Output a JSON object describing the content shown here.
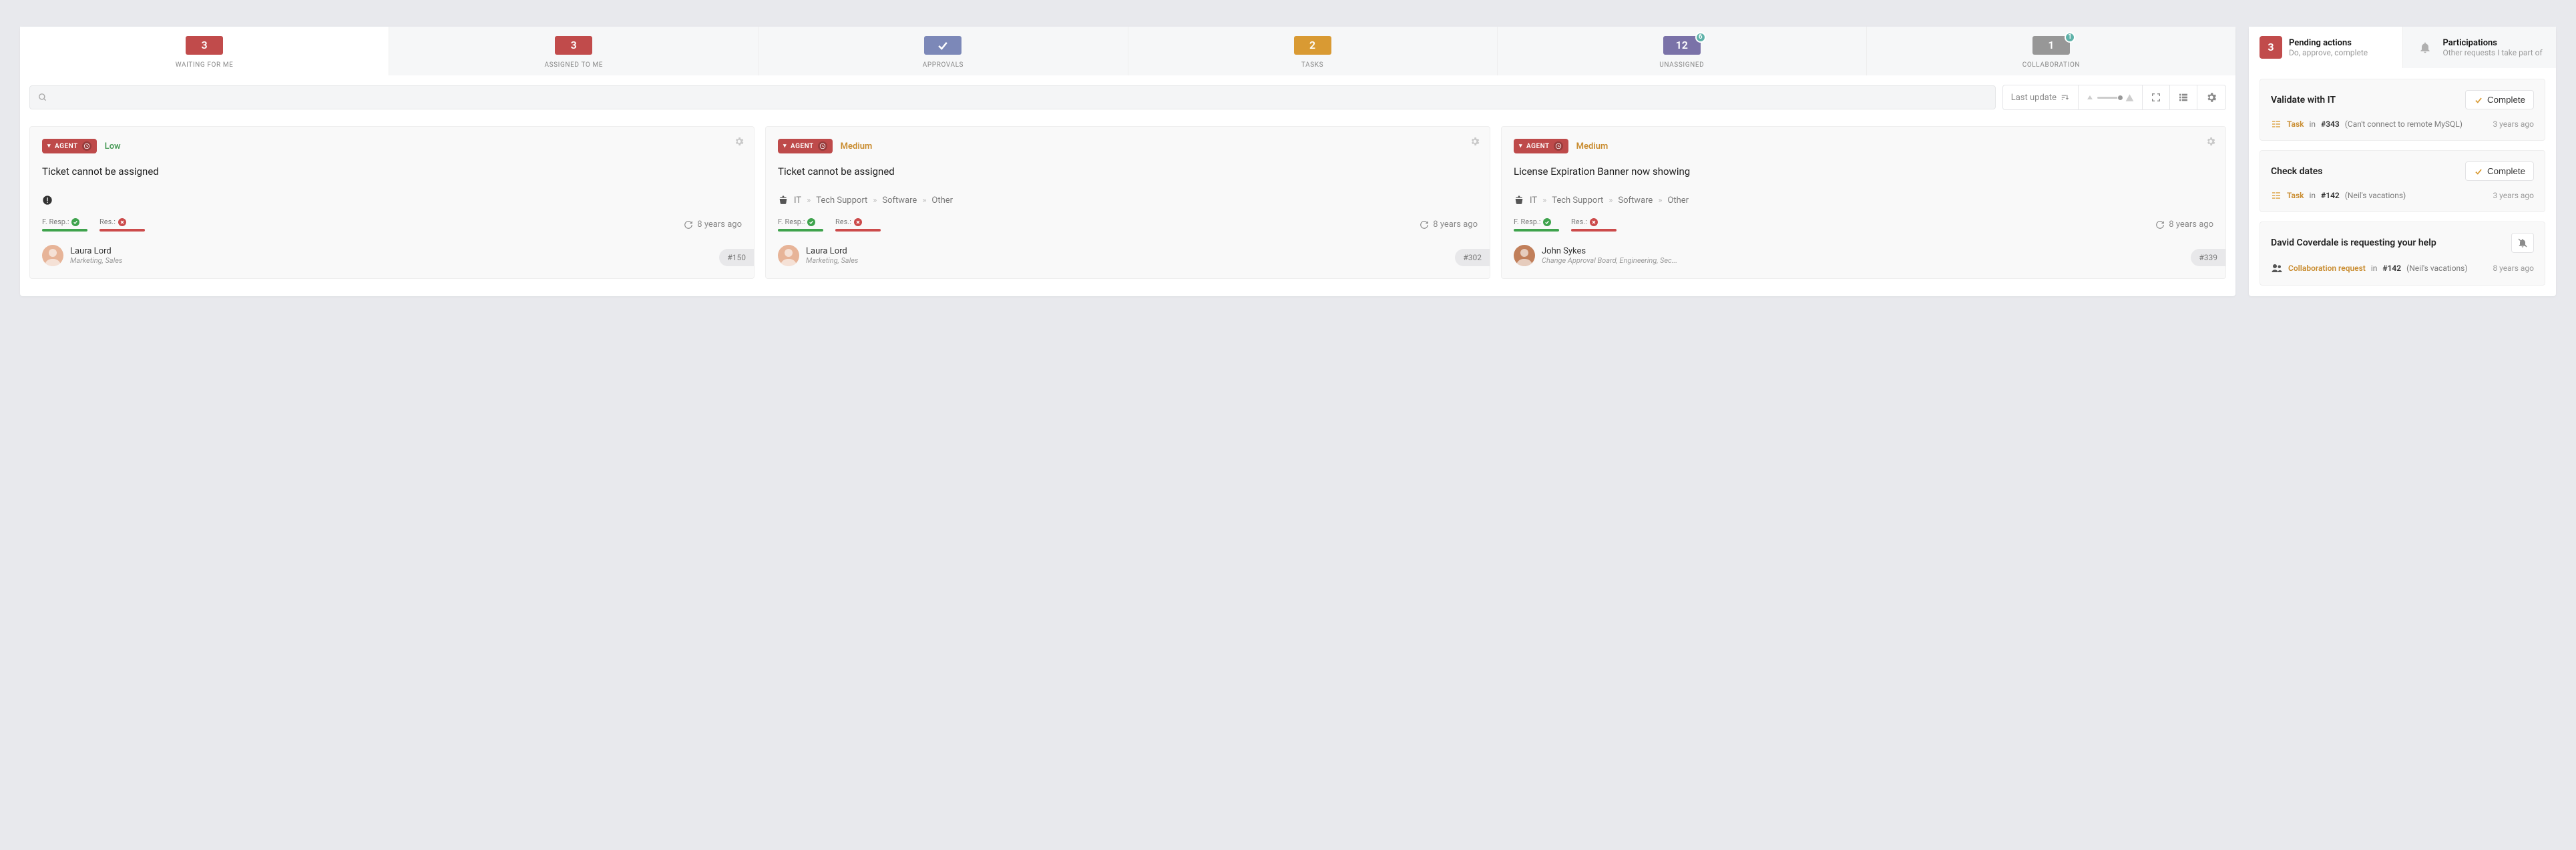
{
  "tabs": [
    {
      "count": "3",
      "label": "WAITING FOR ME",
      "variant": "red",
      "check": false
    },
    {
      "count": "3",
      "label": "ASSIGNED TO ME",
      "variant": "red",
      "check": false
    },
    {
      "count": "",
      "label": "APPROVALS",
      "variant": "blue",
      "check": true
    },
    {
      "count": "2",
      "label": "TASKS",
      "variant": "orange",
      "check": false
    },
    {
      "count": "12",
      "label": "UNASSIGNED",
      "variant": "purple",
      "check": false,
      "dot": "6"
    },
    {
      "count": "1",
      "label": "COLLABORATION",
      "variant": "grey",
      "check": false,
      "dot": "1"
    }
  ],
  "toolbar": {
    "sort_label": "Last update"
  },
  "cards": [
    {
      "agent": "AGENT",
      "priority": "Low",
      "priority_class": "low",
      "title": "Ticket cannot be assigned",
      "breadcrumbs": [],
      "fresp": "F. Resp.:",
      "res": "Res.:",
      "updated": "8 years ago",
      "assignee_name": "Laura Lord",
      "assignee_dept": "Marketing, Sales",
      "ticket": "#150",
      "avatar_bg": "#e7b498"
    },
    {
      "agent": "AGENT",
      "priority": "Medium",
      "priority_class": "medium",
      "title": "Ticket cannot be assigned",
      "breadcrumbs": [
        "IT",
        "Tech Support",
        "Software",
        "Other"
      ],
      "fresp": "F. Resp.:",
      "res": "Res.:",
      "updated": "8 years ago",
      "assignee_name": "Laura Lord",
      "assignee_dept": "Marketing, Sales",
      "ticket": "#302",
      "avatar_bg": "#e7b498"
    },
    {
      "agent": "AGENT",
      "priority": "Medium",
      "priority_class": "medium",
      "title": "License Expiration Banner now showing",
      "breadcrumbs": [
        "IT",
        "Tech Support",
        "Software",
        "Other"
      ],
      "fresp": "F. Resp.:",
      "res": "Res.:",
      "updated": "8 years ago",
      "assignee_name": "John Sykes",
      "assignee_dept": "Change Approval Board, Engineering, Sec...",
      "ticket": "#339",
      "avatar_bg": "#c17f5a"
    }
  ],
  "right_tabs": {
    "pending_count": "3",
    "pending_title": "Pending actions",
    "pending_sub": "Do, approve, complete",
    "part_title": "Participations",
    "part_sub": "Other requests I take part of"
  },
  "right": [
    {
      "title": "Validate with IT",
      "action": "complete",
      "action_label": "Complete",
      "type_label": "Task",
      "in_label": "in",
      "ref": "#343",
      "detail": "(Can't connect to remote MySQL)",
      "time": "3 years ago",
      "icon": "task"
    },
    {
      "title": "Check dates",
      "action": "complete",
      "action_label": "Complete",
      "type_label": "Task",
      "in_label": "in",
      "ref": "#142",
      "detail": "(Neil's vacations)",
      "time": "3 years ago",
      "icon": "task"
    },
    {
      "title": "David Coverdale is requesting your help",
      "action": "mute",
      "type_label": "Collaboration request",
      "in_label": "in",
      "ref": "#142",
      "detail": "(Neil's vacations)",
      "time": "8 years ago",
      "icon": "collab"
    }
  ]
}
